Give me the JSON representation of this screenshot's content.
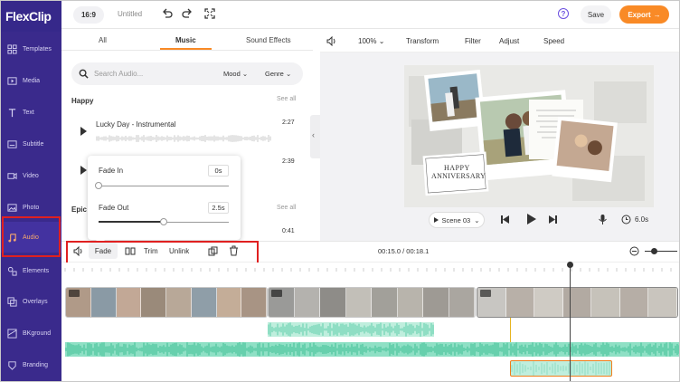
{
  "brand": {
    "logo_text": "FlexClip",
    "accent": "#f98a26",
    "sidebar_bg": "#3a2a8c"
  },
  "sidebar": {
    "items": [
      {
        "label": "Templates",
        "icon": "templates-icon"
      },
      {
        "label": "Media",
        "icon": "media-icon"
      },
      {
        "label": "Text",
        "icon": "text-icon"
      },
      {
        "label": "Subtitle",
        "icon": "subtitle-icon"
      },
      {
        "label": "Video",
        "icon": "video-icon"
      },
      {
        "label": "Photo",
        "icon": "photo-icon"
      },
      {
        "label": "Audio",
        "icon": "music-note-icon",
        "active": true
      },
      {
        "label": "Elements",
        "icon": "elements-icon"
      },
      {
        "label": "Overlays",
        "icon": "overlays-icon"
      },
      {
        "label": "BKground",
        "icon": "background-icon"
      },
      {
        "label": "Branding",
        "icon": "branding-icon"
      }
    ]
  },
  "topbar": {
    "ratio": "16:9",
    "title": "Untitled",
    "help": "?",
    "save": "Save",
    "export": "Export"
  },
  "audio_panel": {
    "tabs": [
      "All",
      "Music",
      "Sound Effects"
    ],
    "active_tab": "Music",
    "search_placeholder": "Search Audio...",
    "filters": [
      "Mood",
      "Genre"
    ],
    "sections": [
      {
        "title": "Happy",
        "see_all": "See all",
        "tracks": [
          {
            "name": "Lucky Day - Instrumental",
            "duration": "2:27"
          },
          {
            "name": "",
            "duration": "2:39"
          }
        ]
      },
      {
        "title": "Epic",
        "see_all": "See all",
        "tracks": [
          {
            "name": "",
            "duration": "0:41"
          }
        ]
      }
    ]
  },
  "fade_popup": {
    "fade_in": {
      "label": "Fade In",
      "value": "0s",
      "level": 0.0
    },
    "fade_out": {
      "label": "Fade Out",
      "value": "2.5s",
      "level": 0.5
    }
  },
  "preview": {
    "toolbar": {
      "volume": "100%",
      "items": [
        "Transform",
        "Filter",
        "Adjust",
        "Speed"
      ]
    },
    "card_text": {
      "line1": "HAPPY",
      "line2": "ANNIVERSARY"
    },
    "scene_label": "Scene 03",
    "duration": "6.0s"
  },
  "timeline": {
    "toolbar": {
      "fade": "Fade",
      "trim": "Trim",
      "unlink": "Unlink"
    },
    "time": "00:15.0 / 00:18.1",
    "playhead_fraction": 0.82
  }
}
